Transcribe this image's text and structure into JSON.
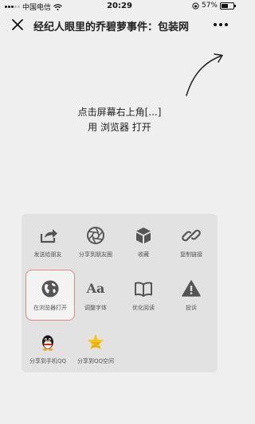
{
  "status": {
    "carrier": "中国电信",
    "time": "20:29",
    "battery": "57%",
    "battery_level": 0.57
  },
  "nav": {
    "title": "经纪人眼里的乔碧萝事件：包装网",
    "close_icon": "close-icon",
    "more_icon": "more-icon"
  },
  "hint": {
    "line1": "点击屏幕右上角[...]",
    "line2": "用 浏览器 打开"
  },
  "menu": {
    "items": [
      {
        "label": "发送给朋友",
        "icon": "share-arrow-icon"
      },
      {
        "label": "分享到朋友圈",
        "icon": "camera-shutter-icon"
      },
      {
        "label": "收藏",
        "icon": "cube-icon"
      },
      {
        "label": "复制链接",
        "icon": "link-icon"
      },
      {
        "label": "在浏览器打开",
        "icon": "globe-icon"
      },
      {
        "label": "调整字体",
        "icon": "font-size-icon"
      },
      {
        "label": "优化阅读",
        "icon": "book-icon"
      },
      {
        "label": "投诉",
        "icon": "warning-icon"
      },
      {
        "label": "分享到手机QQ",
        "icon": "qq-penguin-icon"
      },
      {
        "label": "分享到QQ空间",
        "icon": "qzone-star-icon"
      }
    ]
  }
}
